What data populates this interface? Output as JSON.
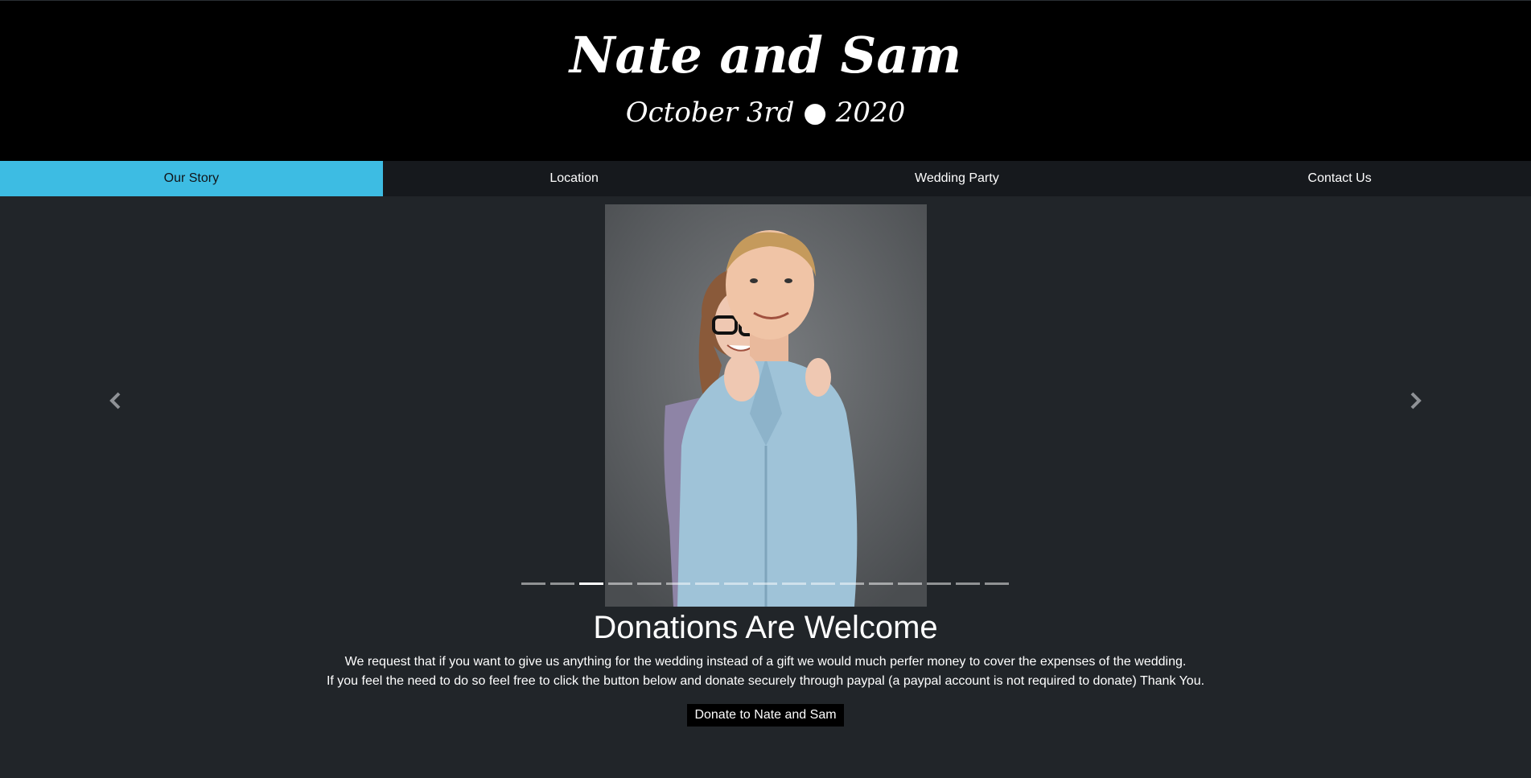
{
  "header": {
    "title": "Nate and Sam",
    "date": "October 3rd ● 2020"
  },
  "nav": {
    "items": [
      {
        "label": "Our Story",
        "active": true
      },
      {
        "label": "Location",
        "active": false
      },
      {
        "label": "Wedding Party",
        "active": false
      },
      {
        "label": "Contact Us",
        "active": false
      }
    ]
  },
  "carousel": {
    "prev_icon": "chevron-left-icon",
    "next_icon": "chevron-right-icon",
    "slide_count": 17,
    "active_index": 2
  },
  "donations": {
    "title": "Donations Are Welcome",
    "line1": "We request that if you want to give us anything for the wedding instead of a gift we would much perfer money to cover the expenses of the wedding.",
    "line2": "If you feel the need to do so feel free to click the button below and donate securely through paypal (a paypal account is not required to donate) Thank You.",
    "button_label": "Donate to Nate and Sam"
  },
  "colors": {
    "header_bg": "#000000",
    "nav_bg": "#16191d",
    "nav_active": "#3dbce3",
    "page_bg": "#212529"
  }
}
